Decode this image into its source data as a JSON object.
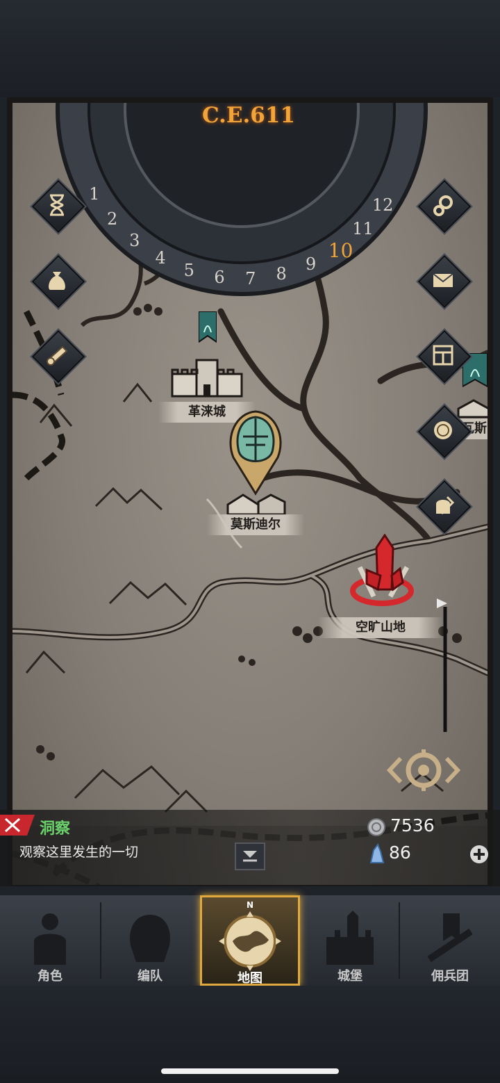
{
  "calendar": {
    "era": "C.E.611",
    "month_numbers": [
      "1",
      "2",
      "3",
      "4",
      "5",
      "6",
      "7",
      "8",
      "9",
      "10",
      "11",
      "12"
    ],
    "current_month": "10"
  },
  "side_buttons": {
    "left": [
      "hourglass-icon",
      "money-bag-icon",
      "scroll-icon"
    ],
    "right": [
      "gears-icon",
      "envelope-icon",
      "ledger-icon",
      "coin-icon",
      "armor-icon"
    ]
  },
  "map": {
    "locations": {
      "gelai_city": "革涞城",
      "mosidier": "莫斯迪尔",
      "kuangye_highland": "空旷山地",
      "partial_east": "瓦斯"
    }
  },
  "info": {
    "mode_title": "洞察",
    "mode_description": "观察这里发生的一切"
  },
  "resources": {
    "silver": "7536",
    "crystal": "86"
  },
  "nav": {
    "items": [
      {
        "label": "角色",
        "icon": "knight-icon"
      },
      {
        "label": "编队",
        "icon": "helmet-squad-icon"
      },
      {
        "label": "地图",
        "icon": "compass-map-icon",
        "active": true
      },
      {
        "label": "城堡",
        "icon": "castle-icon"
      },
      {
        "label": "佣兵团",
        "icon": "banner-sword-icon"
      }
    ],
    "compass_letter": "N"
  },
  "colors": {
    "accent_gold": "#e0a93d",
    "era_orange": "#f0a43a",
    "mode_green": "#6bd16b",
    "marker_red": "#d4282d",
    "banner_teal": "#2e6e6a"
  }
}
